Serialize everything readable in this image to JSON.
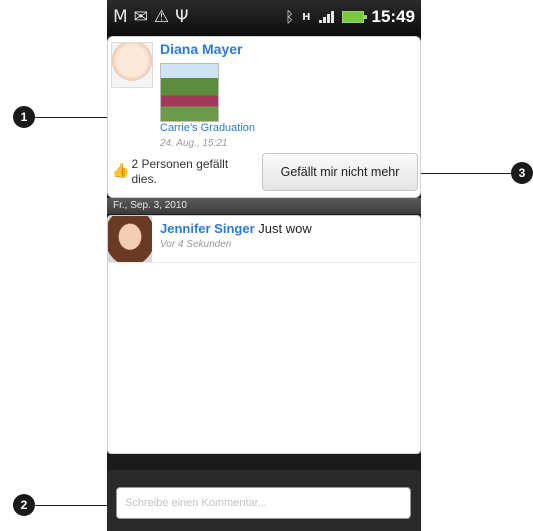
{
  "statusbar": {
    "left_icons": [
      "gmail-icon",
      "mail-icon",
      "warning-icon",
      "usb-icon"
    ],
    "right_icons": [
      "bluetooth-icon",
      "hsdpa-icon",
      "signal-icon",
      "battery-icon"
    ],
    "hsdpa": "H",
    "time": "15:49"
  },
  "post": {
    "author": "Diana Mayer",
    "album": "Carrie's Graduation",
    "date": "24. Aug., 15:21",
    "likes_text": "2 Personen gefällt dies.",
    "unlike_button": "Gefällt mir nicht mehr"
  },
  "date_header": "Fr., Sep. 3, 2010",
  "comment": {
    "author": "Jennifer Singer",
    "text": "Just wow",
    "time": "Vor 4 Sekunden"
  },
  "comment_input": {
    "placeholder": "Schreibe einen Kommentar..."
  },
  "callouts": [
    "1",
    "2",
    "3"
  ],
  "colors": {
    "link_blue": "#2b7bd6",
    "status_bar": "#0d0d0d",
    "battery": "#78c840"
  }
}
